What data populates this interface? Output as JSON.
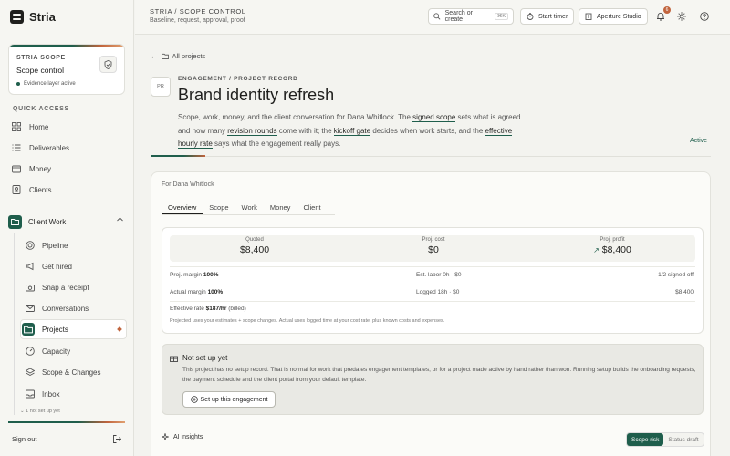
{
  "app": {
    "name": "Stria"
  },
  "scope_card": {
    "label": "STRIA SCOPE",
    "title": "Scope control",
    "status": "Evidence layer active"
  },
  "sidebar": {
    "section_label": "QUICK ACCESS",
    "items": [
      {
        "label": "Home",
        "icon": "grid-icon"
      },
      {
        "label": "Deliverables",
        "icon": "list-icon"
      },
      {
        "label": "Money",
        "icon": "wallet-icon"
      },
      {
        "label": "Clients",
        "icon": "contact-icon"
      }
    ],
    "group": {
      "label": "Client Work"
    },
    "sub_items": [
      {
        "label": "Pipeline",
        "icon": "target-icon"
      },
      {
        "label": "Get hired",
        "icon": "megaphone-icon"
      },
      {
        "label": "Snap a receipt",
        "icon": "camera-icon"
      },
      {
        "label": "Conversations",
        "icon": "mail-icon"
      },
      {
        "label": "Projects",
        "icon": "folder-icon",
        "active": true
      },
      {
        "label": "Capacity",
        "icon": "gauge-icon"
      },
      {
        "label": "Scope & Changes",
        "icon": "layers-icon"
      },
      {
        "label": "Inbox",
        "icon": "inbox-icon"
      }
    ],
    "not_set_up": "1 not set up yet",
    "sign_out": "Sign out"
  },
  "topbar": {
    "crumb": "STRIA / SCOPE CONTROL",
    "crumb_sub": "Baseline, request, approval, proof",
    "search_placeholder": "Search or create",
    "search_kbd": "⌘K",
    "start_timer": "Start timer",
    "studio": "Aperture Studio",
    "notifications": "6"
  },
  "project": {
    "back": "All projects",
    "initials": "PR",
    "eyebrow": "ENGAGEMENT / PROJECT RECORD",
    "title": "Brand identity refresh",
    "desc_1": "Scope, work, money, and the client conversation for Dana Whitlock. The ",
    "desc_signed": "signed scope",
    "desc_2": " sets what is agreed and how many ",
    "desc_revisions": "revision rounds",
    "desc_3": " come with it; the ",
    "desc_kickoff": "kickoff gate",
    "desc_4": " decides when work starts, and the ",
    "desc_rate": "effective hourly rate",
    "desc_5": " says what the engagement really pays.",
    "status": "Active"
  },
  "panel": {
    "for_label": "For Dana Whitlock",
    "tabs": [
      "Overview",
      "Scope",
      "Work",
      "Money",
      "Client"
    ],
    "stats": {
      "quoted_k": "Quoted",
      "quoted_v": "$8,400",
      "cost_k": "Proj. cost",
      "cost_v": "$0",
      "profit_k": "Proj. profit",
      "profit_v": "$8,400"
    },
    "rows": {
      "proj_margin_k": "Proj. margin",
      "proj_margin_v": "100%",
      "est_labor": "Est. labor 0h · $0",
      "signed": "1/2 signed off",
      "actual_margin_k": "Actual margin",
      "actual_margin_v": "100%",
      "logged": "Logged 18h · $0",
      "actual_amount": "$8,400",
      "rate_k": "Effective rate",
      "rate_v": "$187/hr",
      "rate_note": "(billed)"
    },
    "footnote": "Projected uses your estimates + scope changes. Actual uses logged time at your cost rate, plus known costs and expenses.",
    "setup": {
      "heading": "Not set up yet",
      "body": "This project has no setup record. That is normal for work that predates engagement templates, or for a project made active by hand rather than won. Running setup builds the onboarding requests, the payment schedule and the client portal from your default template.",
      "button": "Set up this engagement"
    },
    "ai": {
      "label": "AI insights",
      "seg_on": "Scope risk",
      "seg_off": "Status draft"
    }
  }
}
